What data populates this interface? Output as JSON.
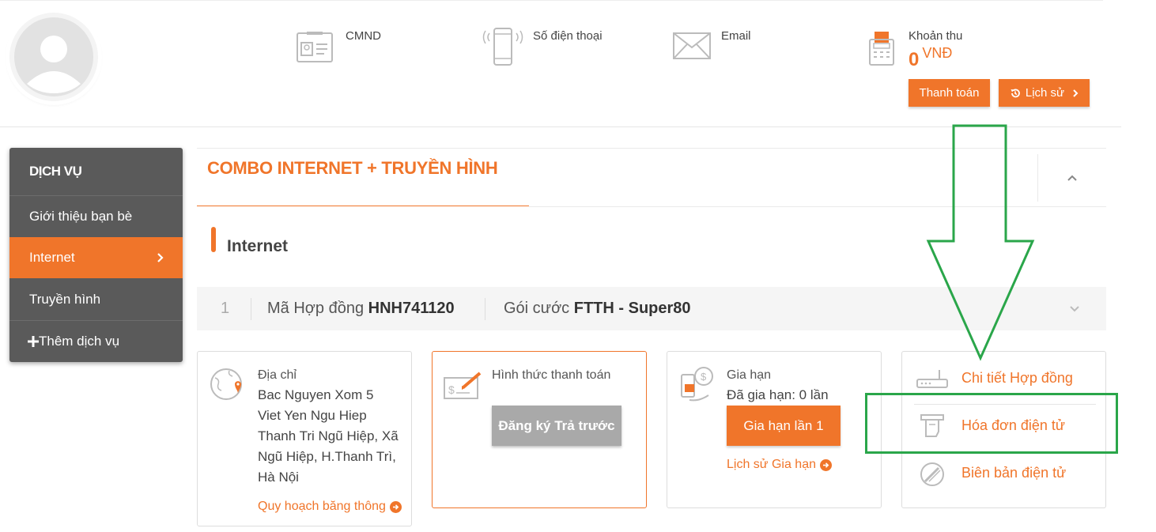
{
  "header": {
    "id_label": "CMND",
    "phone_label": "Số điện thoại",
    "email_label": "Email",
    "balance_label": "Khoản thu",
    "balance_amount": "0",
    "balance_currency": "VNĐ",
    "pay_button": "Thanh toán",
    "history_button": "Lịch sử"
  },
  "sidebar": {
    "header": "DỊCH VỤ",
    "items": [
      {
        "label": "Giới thiệu bạn bè",
        "active": false
      },
      {
        "label": "Internet",
        "active": true
      },
      {
        "label": "Truyền hình",
        "active": false
      },
      {
        "label": "Thêm dịch vụ",
        "active": false
      }
    ]
  },
  "main": {
    "combo_title": "COMBO INTERNET + TRUYỀN HÌNH",
    "section_title": "Internet",
    "contract": {
      "index": "1",
      "contract_label": "Mã Hợp đồng",
      "contract_code": "HNH741120",
      "plan_label": "Gói cước",
      "plan_name": "FTTH - Super80"
    },
    "address_card": {
      "label": "Địa chỉ",
      "lines": [
        "Bac Nguyen Xom 5",
        "Viet Yen Ngu Hiep",
        "Thanh Tri Ngũ Hiệp, Xã",
        "Ngũ Hiệp, H.Thanh Trì,",
        "Hà Nội"
      ],
      "link": "Quy hoạch băng thông"
    },
    "payment_card": {
      "label": "Hình thức thanh toán",
      "button": "Đăng ký Trả trước"
    },
    "renew_card": {
      "label": "Gia hạn",
      "status": "Đã gia hạn: 0 lần",
      "button": "Gia hạn lần 1",
      "link": "Lịch sử Gia hạn"
    },
    "links_card": {
      "contract_detail": "Chi tiết Hợp đồng",
      "e_invoice": "Hóa đơn điện tử",
      "e_minutes": "Biên bản điện tử"
    }
  },
  "colors": {
    "accent": "#f0752a",
    "sidebar_bg": "#5a5a5a",
    "annotation": "#2aa64a"
  }
}
